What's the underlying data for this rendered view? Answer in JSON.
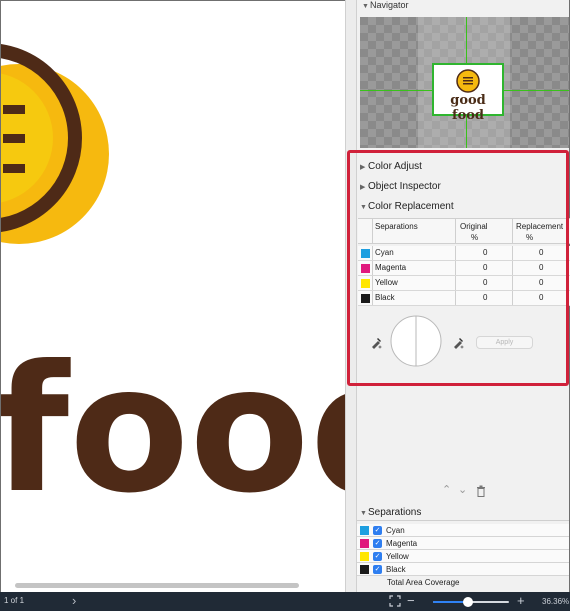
{
  "navigator": {
    "title": "Navigator",
    "thumb_text": "good food"
  },
  "canvas": {
    "big_text": "food"
  },
  "sections": {
    "color_adjust": "Color Adjust",
    "object_inspector": "Object Inspector",
    "color_replacement": "Color Replacement"
  },
  "color_replacement": {
    "headers": {
      "separations": "Separations",
      "original": "Original",
      "replacement": "Replacement",
      "pct": "%"
    },
    "rows": [
      {
        "name": "Cyan",
        "original": "0",
        "replacement": "0",
        "color": "#1e9fe0"
      },
      {
        "name": "Magenta",
        "original": "0",
        "replacement": "0",
        "color": "#e0197d"
      },
      {
        "name": "Yellow",
        "original": "0",
        "replacement": "0",
        "color": "#ffe600"
      },
      {
        "name": "Black",
        "original": "0",
        "replacement": "0",
        "color": "#1a1a1a"
      }
    ],
    "apply_label": "Apply"
  },
  "separations_panel": {
    "title": "Separations",
    "rows": [
      {
        "name": "Cyan",
        "color": "#1e9fe0",
        "checked": true
      },
      {
        "name": "Magenta",
        "color": "#e0197d",
        "checked": true
      },
      {
        "name": "Yellow",
        "color": "#ffe600",
        "checked": true
      },
      {
        "name": "Black",
        "color": "#1a1a1a",
        "checked": true
      }
    ],
    "total_area_coverage": "Total Area Coverage"
  },
  "status_bar": {
    "page": "1 of 1",
    "zoom": "36.36%",
    "zoom_fraction": 0.45
  },
  "colors": {
    "brown": "#4e2a17",
    "gold": "#f6b90f",
    "highlight": "#d0213a",
    "accent": "#2f82f5"
  }
}
